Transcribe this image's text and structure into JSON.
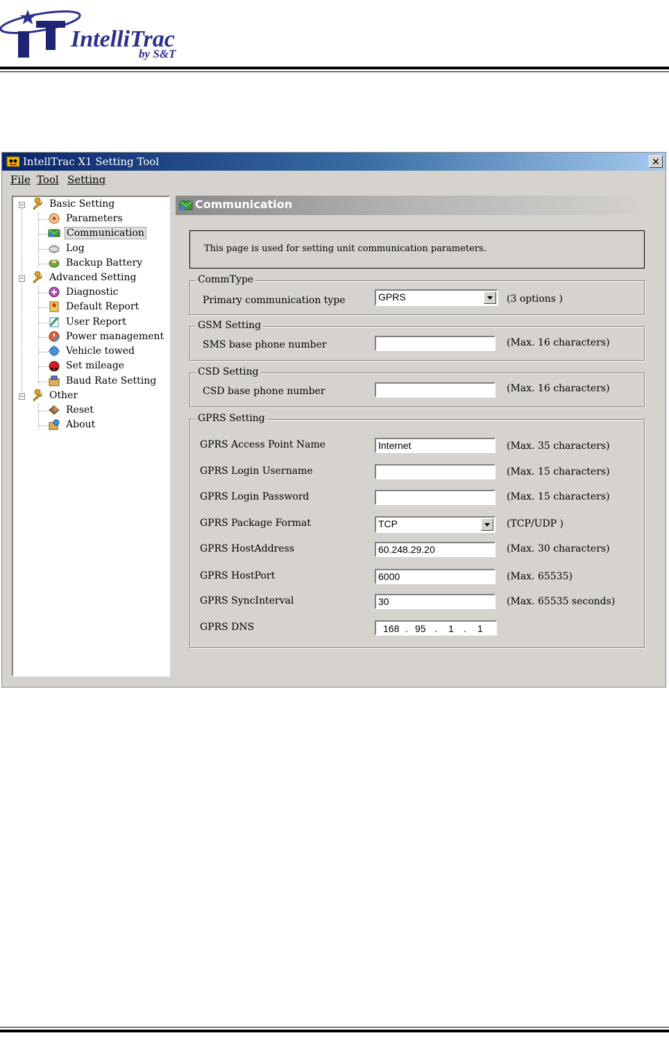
{
  "logo": {
    "text": "IntelliTrac",
    "subtext": "by S&T"
  },
  "window": {
    "title": "IntellTrac X1 Setting Tool",
    "menu": [
      "File",
      "Tool",
      "Setting"
    ]
  },
  "tree": {
    "groups": [
      {
        "label": "Basic Setting",
        "icon": "wrench-icon",
        "items": [
          {
            "label": "Parameters",
            "icon": "parameters-icon"
          },
          {
            "label": "Communication",
            "icon": "communication-icon",
            "selected": true
          },
          {
            "label": "Log",
            "icon": "log-icon"
          },
          {
            "label": "Backup Battery",
            "icon": "battery-icon"
          }
        ]
      },
      {
        "label": "Advanced Setting",
        "icon": "wrench-icon",
        "items": [
          {
            "label": "Diagnostic",
            "icon": "diagnostic-icon"
          },
          {
            "label": "Default Report",
            "icon": "report-icon"
          },
          {
            "label": "User Report",
            "icon": "user-report-icon"
          },
          {
            "label": "Power management",
            "icon": "power-icon"
          },
          {
            "label": "Vehicle towed",
            "icon": "towed-icon"
          },
          {
            "label": "Set mileage",
            "icon": "mileage-icon"
          },
          {
            "label": "Baud Rate Setting",
            "icon": "baud-icon"
          }
        ]
      },
      {
        "label": "Other",
        "icon": "wrench-icon",
        "items": [
          {
            "label": "Reset",
            "icon": "reset-icon"
          },
          {
            "label": "About",
            "icon": "about-icon"
          }
        ]
      }
    ]
  },
  "content": {
    "header": "Communication",
    "description": "This page is used for setting unit communication parameters.",
    "commtype": {
      "title": "CommType",
      "label": "Primary communication type",
      "value": "GPRS",
      "hint": "(3 options )"
    },
    "gsm": {
      "title": "GSM Setting",
      "label": "SMS base phone number",
      "value": "",
      "hint": "(Max. 16 characters)"
    },
    "csd": {
      "title": "CSD Setting",
      "label": "CSD base phone number",
      "value": "",
      "hint": "(Max. 16 characters)"
    },
    "gprs": {
      "title": "GPRS Setting",
      "apn": {
        "label": "GPRS Access Point Name",
        "value": "Internet",
        "hint": "(Max. 35 characters)"
      },
      "user": {
        "label": "GPRS Login Username",
        "value": "",
        "hint": "(Max. 15 characters)"
      },
      "pass": {
        "label": "GPRS Login Password",
        "value": "",
        "hint": "(Max. 15 characters)"
      },
      "format": {
        "label": "GPRS Package Format",
        "value": "TCP",
        "hint": "(TCP/UDP )"
      },
      "host": {
        "label": "GPRS HostAddress",
        "value": "60.248.29.20",
        "hint": "(Max. 30 characters)"
      },
      "port": {
        "label": "GPRS HostPort",
        "value": "6000",
        "hint": "(Max. 65535)"
      },
      "sync": {
        "label": "GPRS SyncInterval",
        "value": "30",
        "hint": "(Max. 65535 seconds)"
      },
      "dns": {
        "label": "GPRS DNS",
        "octets": [
          "168",
          "95",
          "1",
          "1"
        ]
      }
    }
  }
}
